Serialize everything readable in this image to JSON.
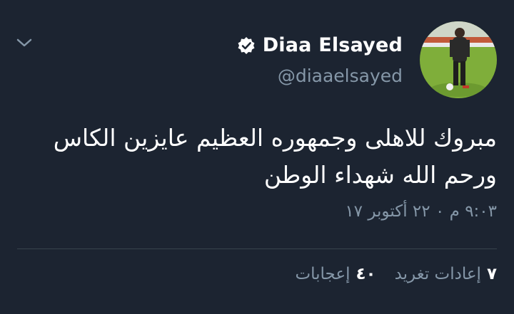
{
  "tweet": {
    "display_name": "Diaa Elsayed",
    "handle": "@diaaelsayed",
    "verified": true,
    "text": "مبروك للاهلى وجمهوره العظيم عايزين الكاس  ورحم الله شهداء الوطن",
    "timestamp": "٩:٠٣ م ٠ ٢٢ أكتوبر ١٧",
    "retweets": {
      "count": "٧",
      "label": "إعادات تغريد"
    },
    "likes": {
      "count": "٤٠",
      "label": "إعجابات"
    }
  },
  "icons": {
    "menu": "chevron-down-icon",
    "verified": "verified-badge-icon"
  },
  "colors": {
    "background": "#1c2431",
    "text": "#ffffff",
    "secondary_text": "#8597a8",
    "divider": "#38444d"
  }
}
